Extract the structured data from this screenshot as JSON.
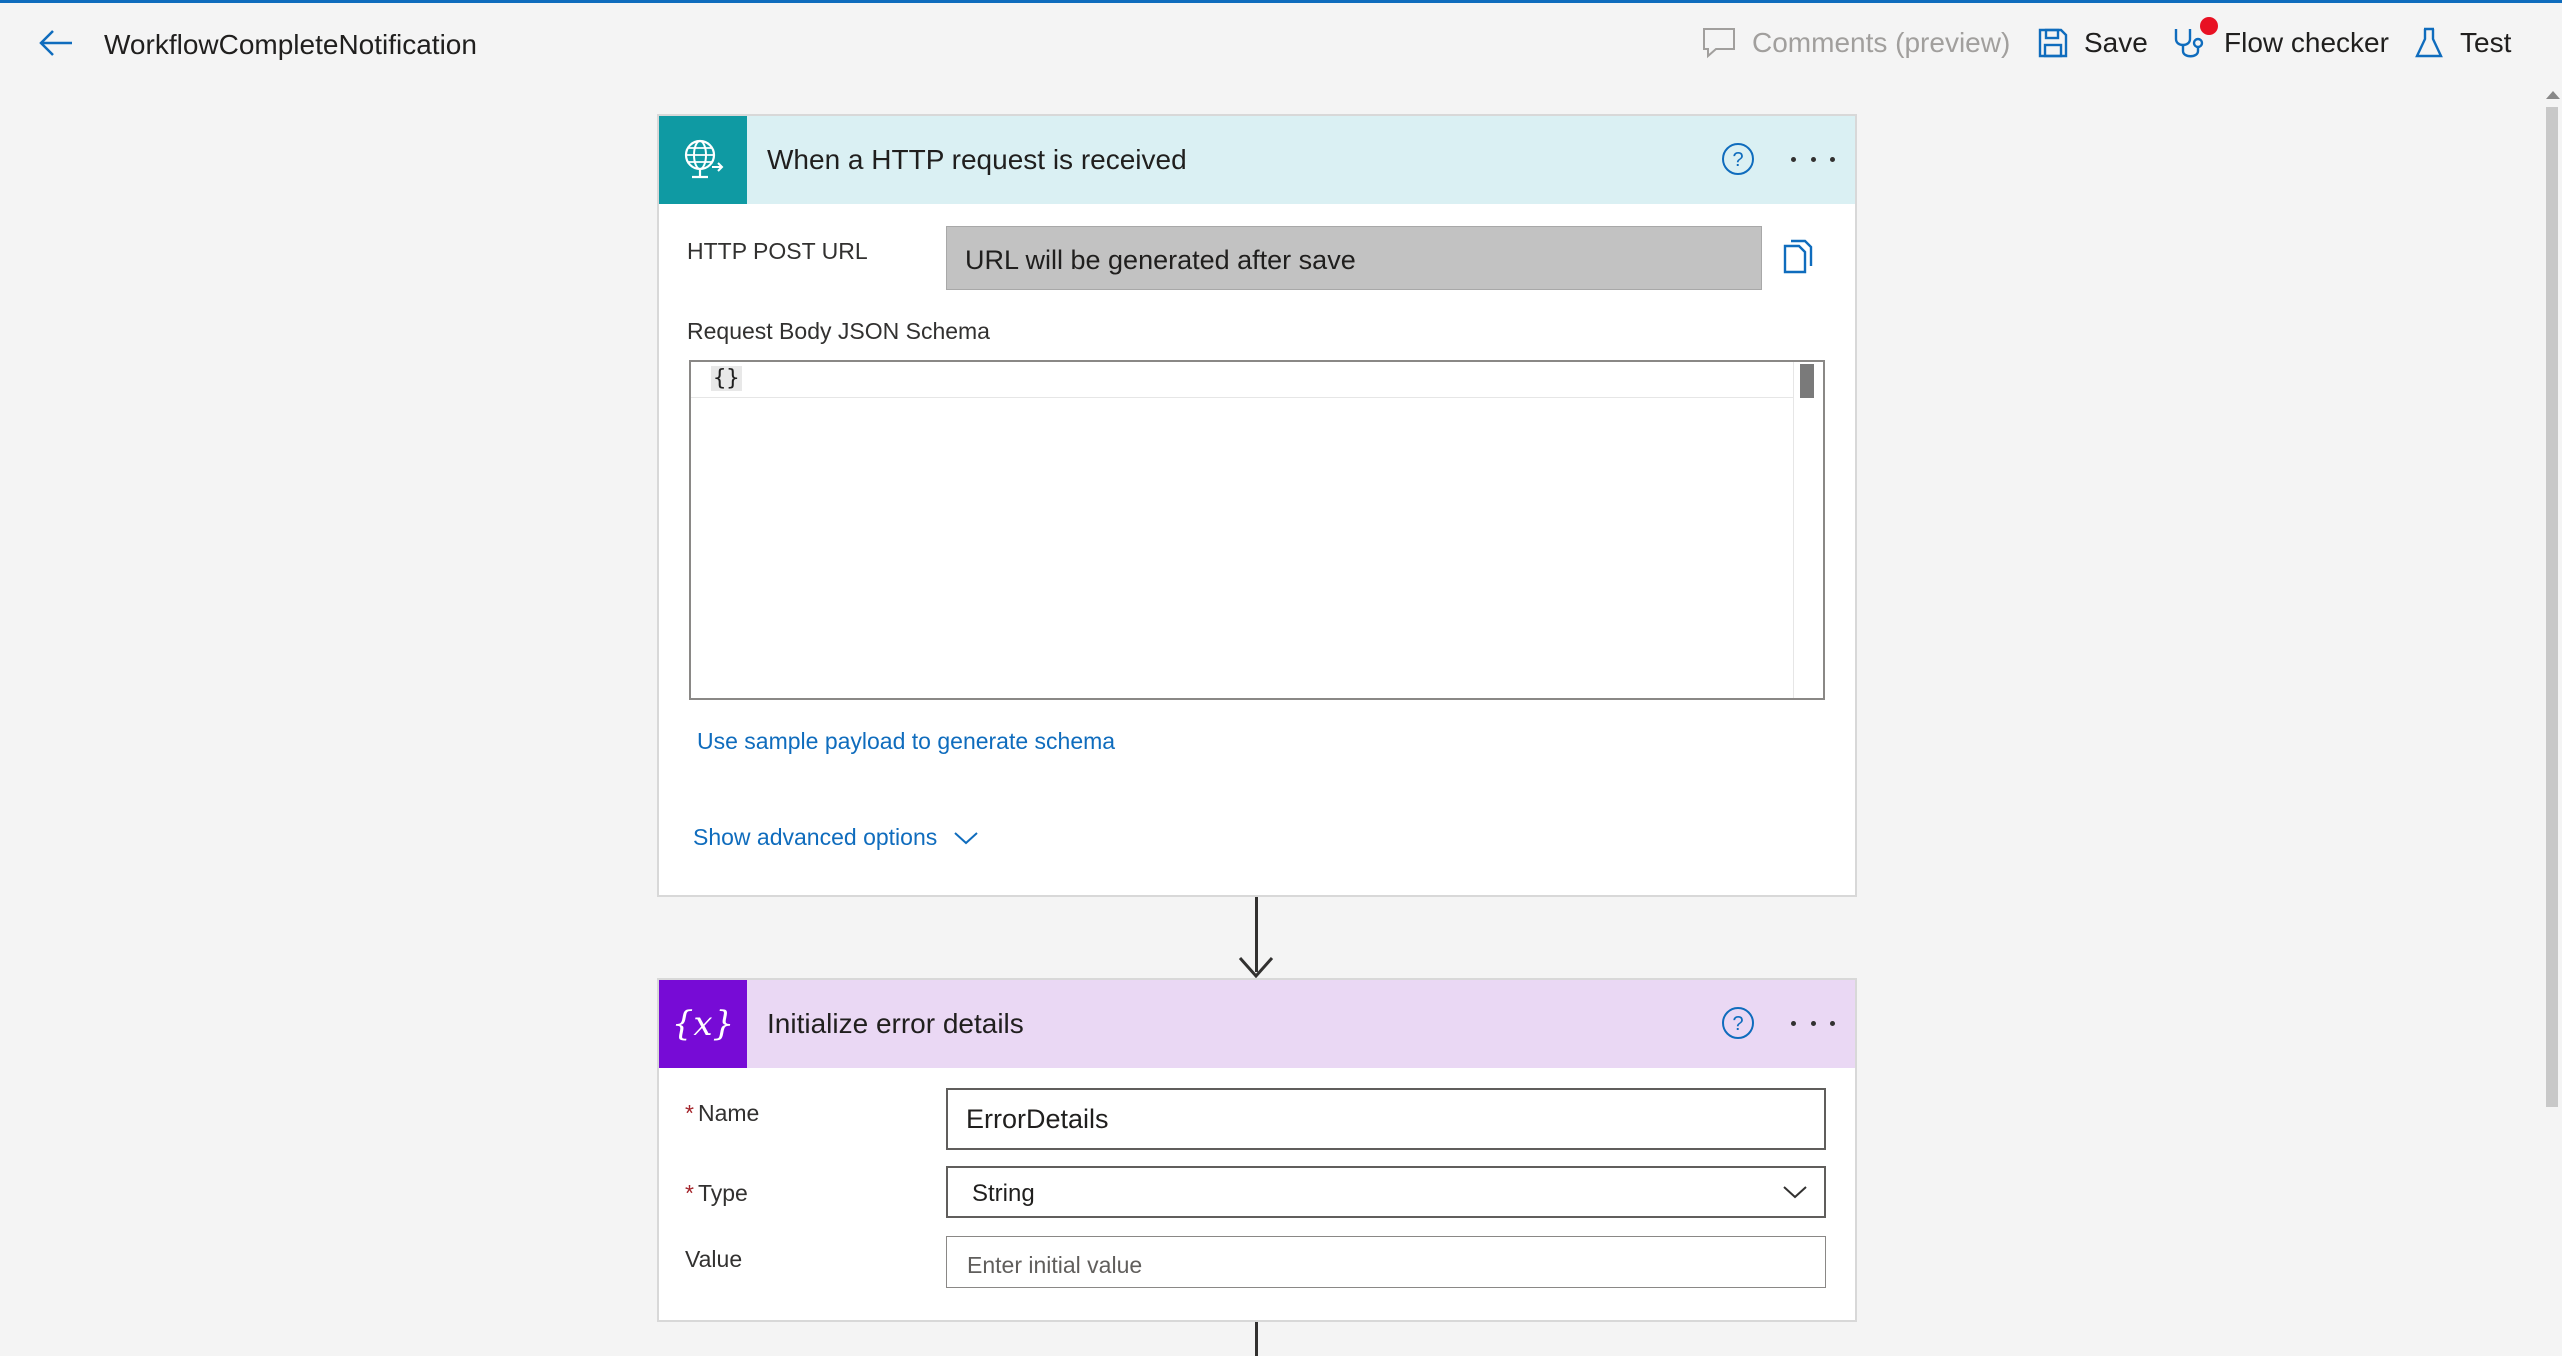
{
  "header": {
    "title": "WorkflowCompleteNotification",
    "comments_label": "Comments (preview)",
    "save_label": "Save",
    "flow_checker_label": "Flow checker",
    "test_label": "Test"
  },
  "trigger_card": {
    "title": "When a HTTP request is received",
    "http_post_url_label": "HTTP POST URL",
    "http_post_url_value": "URL will be generated after save",
    "schema_label": "Request Body JSON Schema",
    "schema_value": "{}",
    "sample_payload_link": "Use sample payload to generate schema",
    "advanced_options_link": "Show advanced options"
  },
  "variable_card": {
    "title": "Initialize error details",
    "name_label": "Name",
    "name_value": "ErrorDetails",
    "type_label": "Type",
    "type_value": "String",
    "value_label": "Value",
    "value_placeholder": "Enter initial value"
  },
  "colors": {
    "accent": "#0f6cbd",
    "trigger_header": "#daf0f3",
    "trigger_icon": "#0f9aa3",
    "variable_header": "#ead8f4",
    "variable_icon": "#770bd6",
    "badge": "#e81123"
  }
}
